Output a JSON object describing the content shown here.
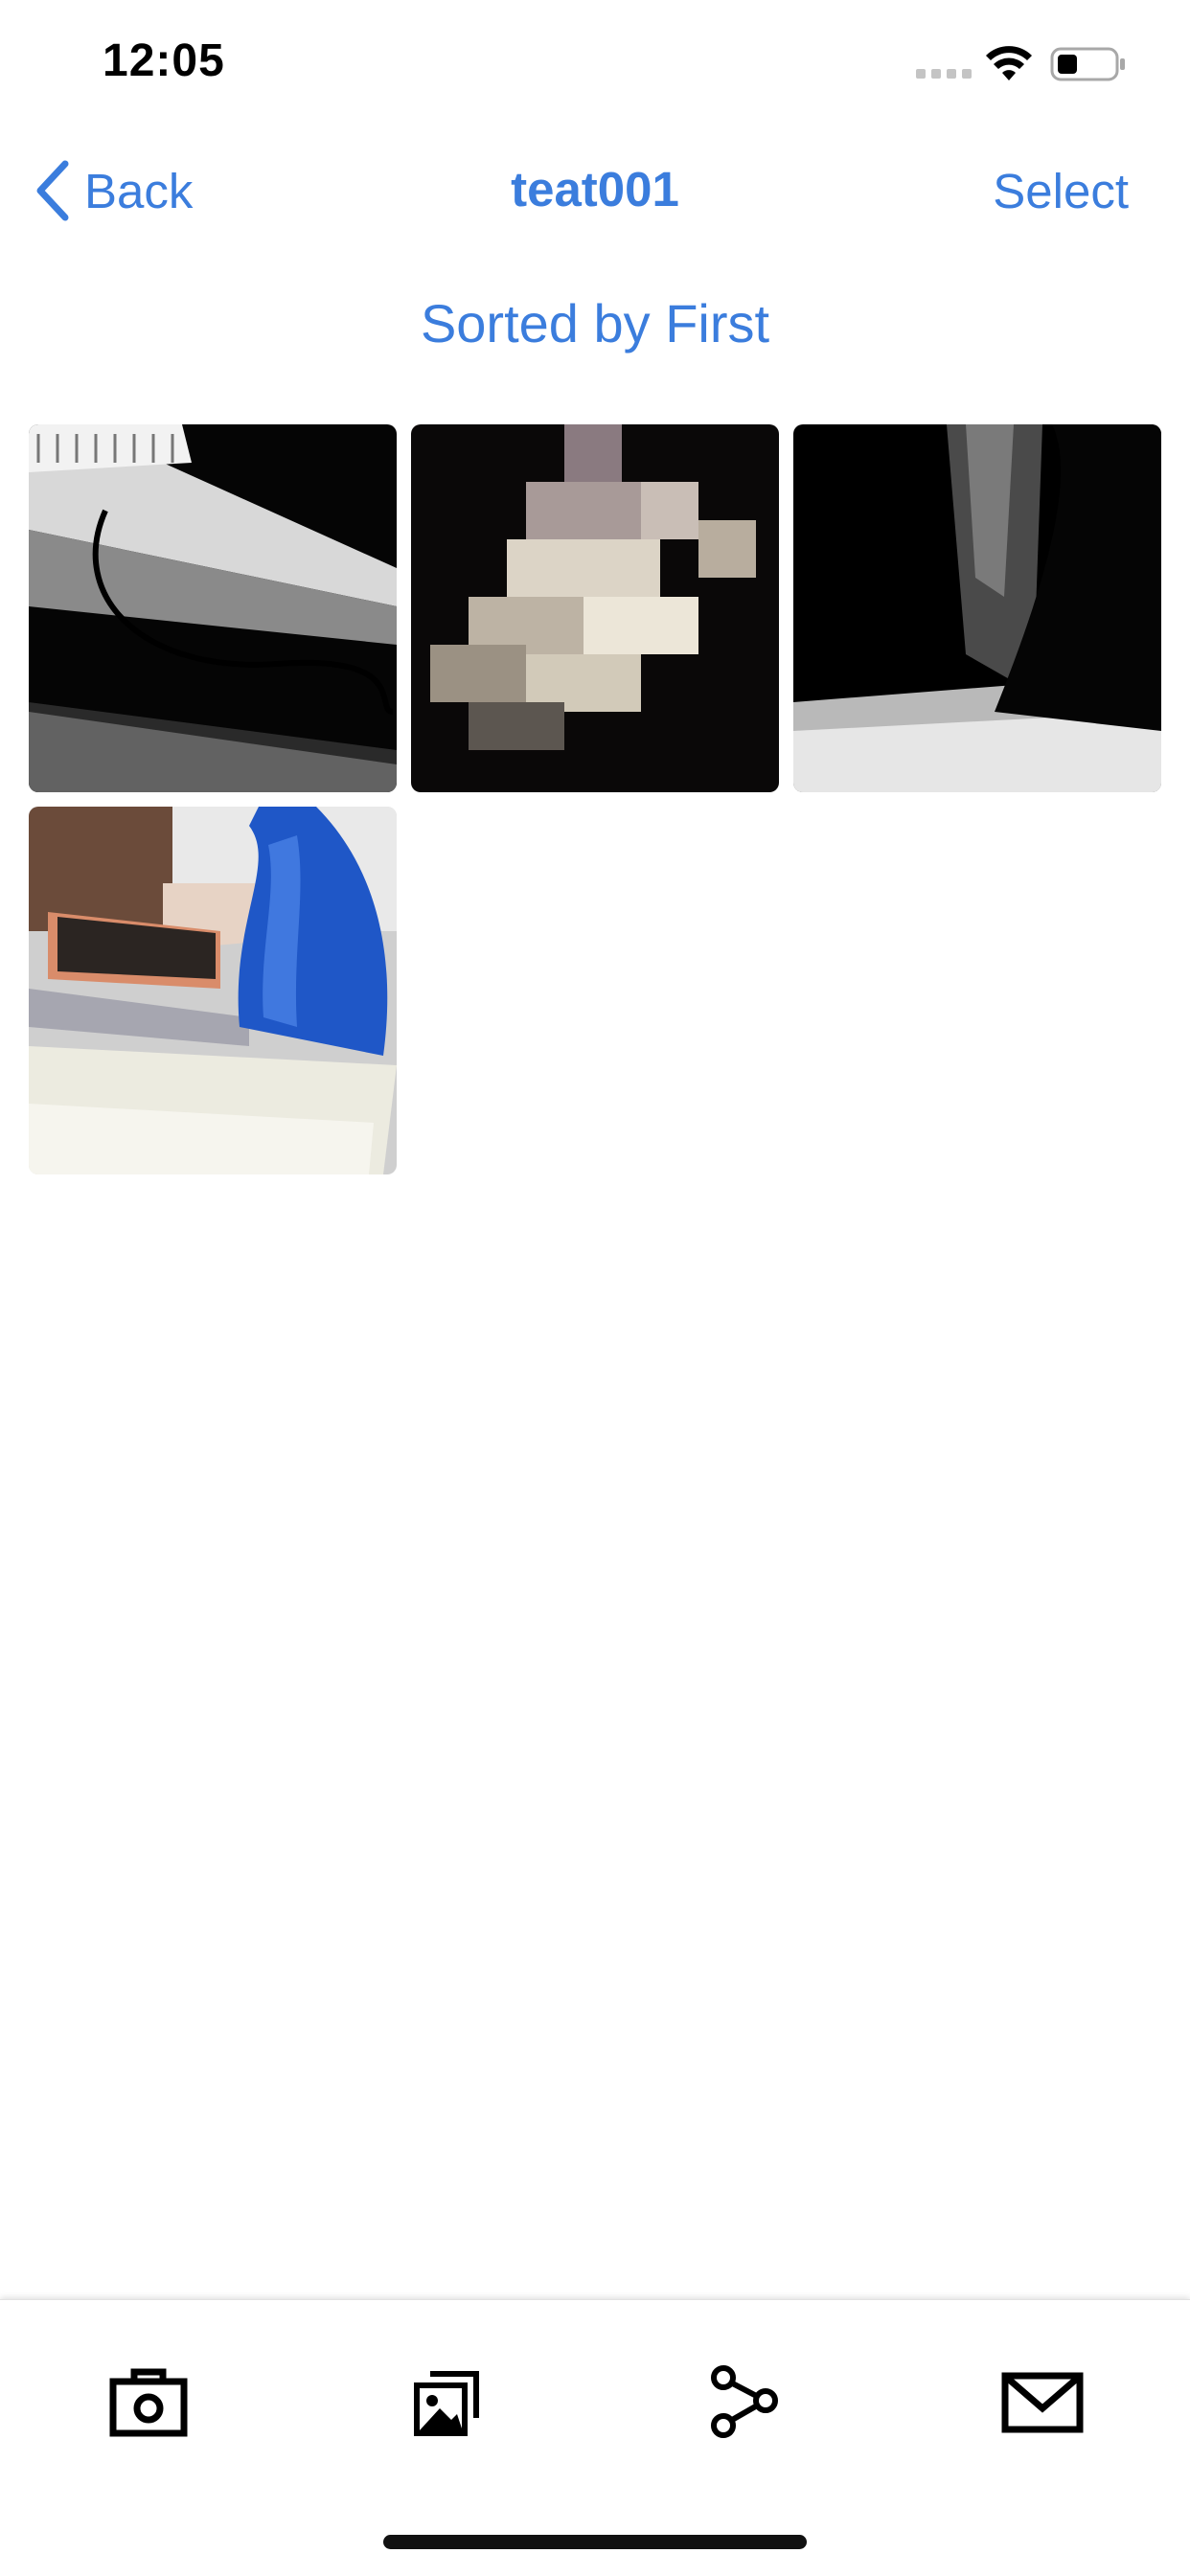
{
  "status_bar": {
    "time": "12:05",
    "icons": [
      "signal-icon",
      "wifi-icon",
      "battery-icon"
    ]
  },
  "nav": {
    "back_label": "Back",
    "title": "teat001",
    "select_label": "Select"
  },
  "sort_label": "Sorted by First",
  "photos": [
    {
      "subject": "notebook-and-cable-photo"
    },
    {
      "subject": "blurred-object-photo"
    },
    {
      "subject": "dark-object-photo"
    },
    {
      "subject": "phone-and-bottle-photo"
    }
  ],
  "toolbar": {
    "icons": [
      "camera-icon",
      "gallery-icon",
      "share-icon",
      "mail-icon"
    ]
  },
  "colors": {
    "accent": "#3b7ddd",
    "text": "#000000",
    "background": "#ffffff"
  }
}
